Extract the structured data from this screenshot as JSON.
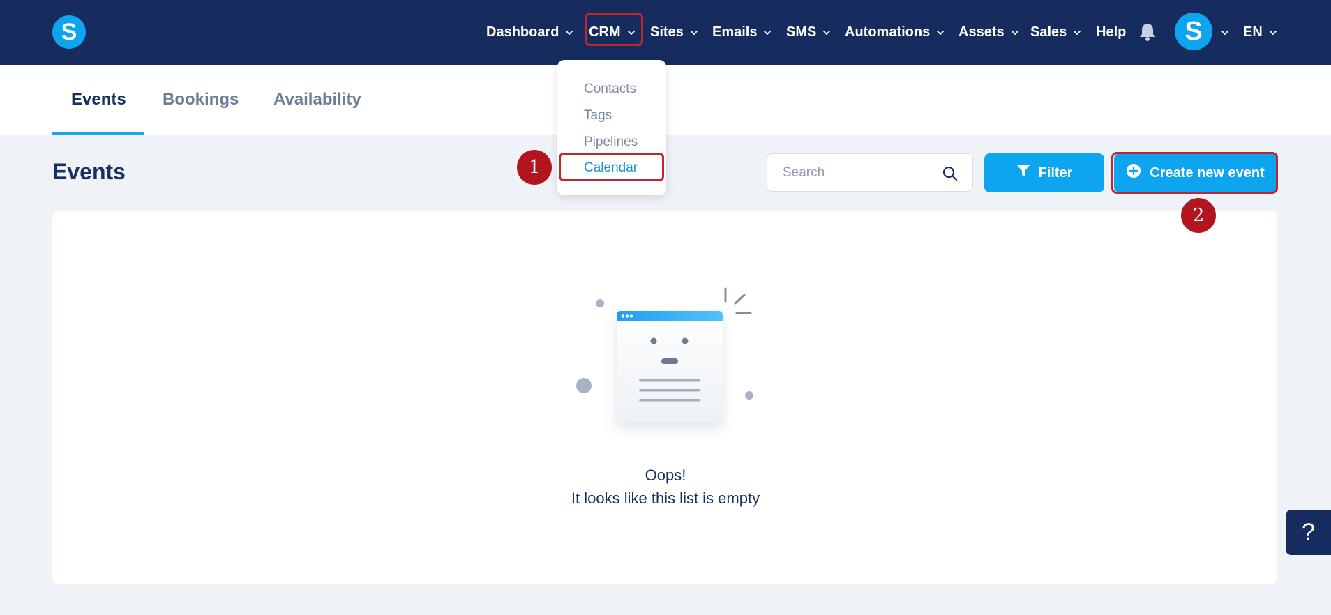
{
  "brand": {
    "logo_letter": "S"
  },
  "nav": {
    "items": [
      {
        "label": "Dashboard",
        "has_dropdown": true
      },
      {
        "label": "CRM",
        "has_dropdown": true
      },
      {
        "label": "Sites",
        "has_dropdown": true
      },
      {
        "label": "Emails",
        "has_dropdown": true
      },
      {
        "label": "SMS",
        "has_dropdown": true
      },
      {
        "label": "Automations",
        "has_dropdown": true
      },
      {
        "label": "Assets",
        "has_dropdown": true
      },
      {
        "label": "Sales",
        "has_dropdown": true
      },
      {
        "label": "Help",
        "has_dropdown": false
      }
    ],
    "avatar_letter": "S",
    "language": "EN"
  },
  "crm_menu": {
    "items": [
      "Contacts",
      "Tags",
      "Pipelines",
      "Calendar"
    ],
    "selected": "Calendar"
  },
  "tabs": [
    {
      "label": "Events",
      "active": true
    },
    {
      "label": "Bookings",
      "active": false
    },
    {
      "label": "Availability",
      "active": false
    }
  ],
  "page": {
    "title": "Events",
    "search_placeholder": "Search",
    "filter_label": "Filter",
    "create_label": "Create new event"
  },
  "annotations": {
    "step1": "1",
    "step2": "2"
  },
  "empty_state": {
    "line1": "Oops!",
    "line2": "It looks like this list is empty"
  },
  "help_button": {
    "label": "?"
  },
  "colors": {
    "nav_bg": "#162c5e",
    "accent": "#0ea5f0",
    "highlight": "#c0262d",
    "badge": "#b3151e",
    "page_bg": "#eff3f8"
  }
}
